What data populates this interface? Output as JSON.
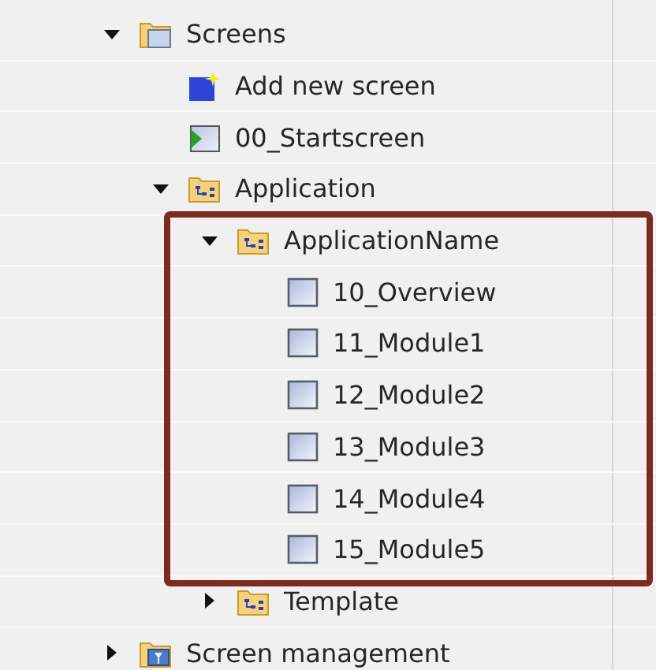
{
  "tree": [
    {
      "kind": "folder",
      "label": "Screens",
      "expanded": true,
      "children": [
        {
          "kind": "add",
          "label": "Add new screen"
        },
        {
          "kind": "start",
          "label": "00_Startscreen"
        },
        {
          "kind": "group",
          "label": "Application",
          "expanded": true,
          "children": [
            {
              "kind": "group",
              "label": "ApplicationName",
              "expanded": true,
              "highlighted": true,
              "children": [
                {
                  "kind": "screen",
                  "label": "10_Overview"
                },
                {
                  "kind": "screen",
                  "label": "11_Module1"
                },
                {
                  "kind": "screen",
                  "label": "12_Module2"
                },
                {
                  "kind": "screen",
                  "label": "13_Module3"
                },
                {
                  "kind": "screen",
                  "label": "14_Module4"
                },
                {
                  "kind": "screen",
                  "label": "15_Module5"
                }
              ]
            },
            {
              "kind": "group",
              "label": "Template",
              "expanded": false
            }
          ]
        }
      ]
    },
    {
      "kind": "manage",
      "label": "Screen management",
      "expanded": false
    }
  ]
}
